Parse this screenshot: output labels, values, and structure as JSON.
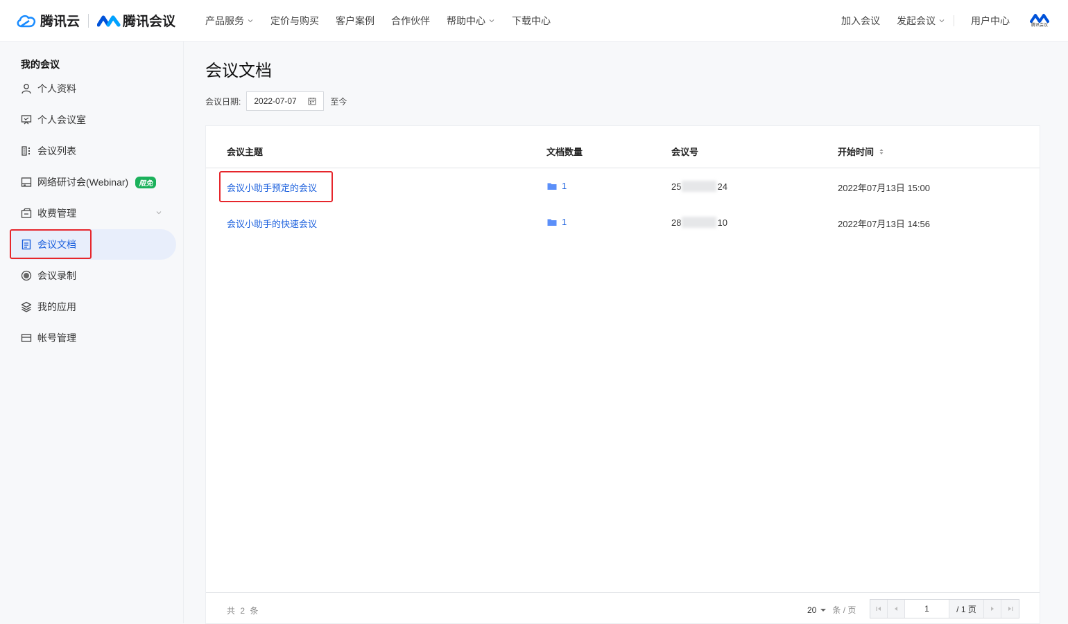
{
  "header": {
    "brand_cloud": "腾讯云",
    "brand_meeting": "腾讯会议",
    "nav": [
      {
        "label": "产品服务",
        "dropdown": true
      },
      {
        "label": "定价与购买",
        "dropdown": false
      },
      {
        "label": "客户案例",
        "dropdown": false
      },
      {
        "label": "合作伙伴",
        "dropdown": false
      },
      {
        "label": "帮助中心",
        "dropdown": true
      },
      {
        "label": "下载中心",
        "dropdown": false
      }
    ],
    "right": {
      "join": "加入会议",
      "start": "发起会议",
      "user_center": "用户中心"
    },
    "avatar_text": "腾讯会议"
  },
  "sidebar": {
    "title": "我的会议",
    "items": [
      {
        "label": "个人资料",
        "icon": "user-icon"
      },
      {
        "label": "个人会议室",
        "icon": "meeting-room-icon"
      },
      {
        "label": "会议列表",
        "icon": "list-icon"
      },
      {
        "label": "网络研讨会(Webinar)",
        "icon": "webinar-icon",
        "badge": "限免"
      },
      {
        "label": "收费管理",
        "icon": "billing-icon"
      },
      {
        "label": "会议文档",
        "icon": "document-icon",
        "active": true
      },
      {
        "label": "会议录制",
        "icon": "record-icon"
      },
      {
        "label": "我的应用",
        "icon": "apps-icon"
      },
      {
        "label": "帐号管理",
        "icon": "account-icon"
      }
    ]
  },
  "main": {
    "title": "会议文档",
    "filter": {
      "label": "会议日期:",
      "date": "2022-07-07",
      "till": "至今"
    },
    "table": {
      "columns": [
        "会议主题",
        "文档数量",
        "会议号",
        "开始时间"
      ],
      "rows": [
        {
          "topic": "会议小助手预定的会议",
          "docs": "1",
          "id_prefix": "25",
          "id_suffix": "24",
          "start": "2022年07月13日 15:00"
        },
        {
          "topic": "会议小助手的快速会议",
          "docs": "1",
          "id_prefix": "28",
          "id_suffix": "10",
          "start": "2022年07月13日 14:56"
        }
      ]
    },
    "footer": {
      "total": "共 2 条",
      "page_size": "20",
      "page_size_unit": "条 / 页",
      "current_page": "1",
      "total_pages": "/ 1 页"
    }
  },
  "colors": {
    "accent": "#1a5fdd",
    "highlight": "#e6262c",
    "badge": "#1bb15b"
  }
}
